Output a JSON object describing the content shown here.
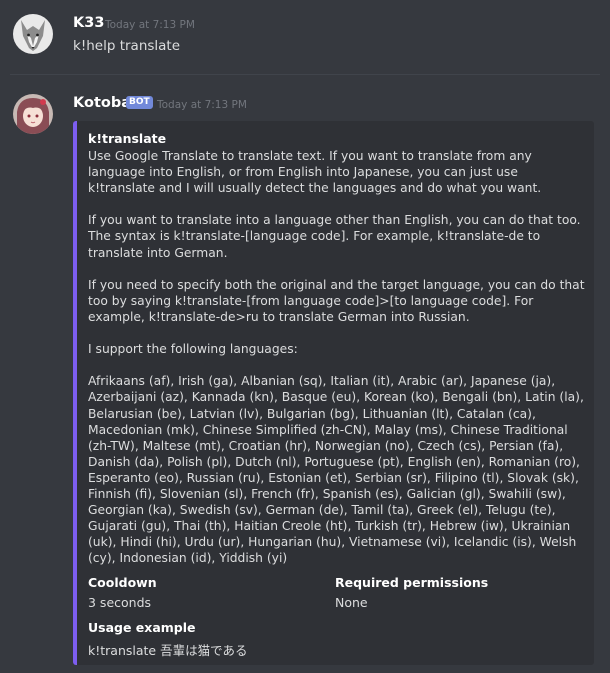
{
  "messages": [
    {
      "author": "K33",
      "timestamp": "Today at 7:13 PM",
      "text": "k!help translate",
      "avatar": "wolf-avatar"
    },
    {
      "author": "Kotoba",
      "badge": "BOT",
      "timestamp": "Today at 7:13 PM",
      "avatar": "anime-girl-avatar",
      "embed": {
        "accent_color": "#7d5ef0",
        "title": "k!translate",
        "description": [
          "Use Google Translate to translate text. If you want to translate from any language into English, or from English into Japanese, you can just use k!translate and I will usually detect the languages and do what you want.",
          "If you want to translate into a language other than English, you can do that too. The syntax is k!translate-[language code]. For example, k!translate-de to translate into German.",
          "If you need to specify both the original and the target language, you can do that too by saying k!translate-[from language code]>[to language code]. For example, k!translate-de>ru to translate German into Russian.",
          "I support the following languages:",
          "Afrikaans (af), Irish (ga), Albanian (sq), Italian (it), Arabic (ar), Japanese (ja), Azerbaijani (az), Kannada (kn), Basque (eu), Korean (ko), Bengali (bn), Latin (la), Belarusian (be), Latvian (lv), Bulgarian (bg), Lithuanian (lt), Catalan (ca), Macedonian (mk), Chinese Simplified (zh-CN), Malay (ms), Chinese Traditional (zh-TW), Maltese (mt), Croatian (hr), Norwegian (no), Czech (cs), Persian (fa), Danish (da), Polish (pl), Dutch (nl), Portuguese (pt), English (en), Romanian (ro), Esperanto (eo), Russian (ru), Estonian (et), Serbian (sr), Filipino (tl), Slovak (sk), Finnish (fi), Slovenian (sl), French (fr), Spanish (es), Galician (gl), Swahili (sw), Georgian (ka), Swedish (sv), German (de), Tamil (ta), Greek (el), Telugu (te), Gujarati (gu), Thai (th), Haitian Creole (ht), Turkish (tr), Hebrew (iw), Ukrainian (uk), Hindi (hi), Urdu (ur), Hungarian (hu), Vietnamese (vi), Icelandic (is), Welsh (cy), Indonesian (id), Yiddish (yi)"
        ],
        "fields": [
          {
            "name": "Cooldown",
            "value": "3 seconds"
          },
          {
            "name": "Required permissions",
            "value": "None"
          },
          {
            "name": "Usage example",
            "value": "k!translate 吾輩は猫である"
          }
        ]
      }
    }
  ]
}
